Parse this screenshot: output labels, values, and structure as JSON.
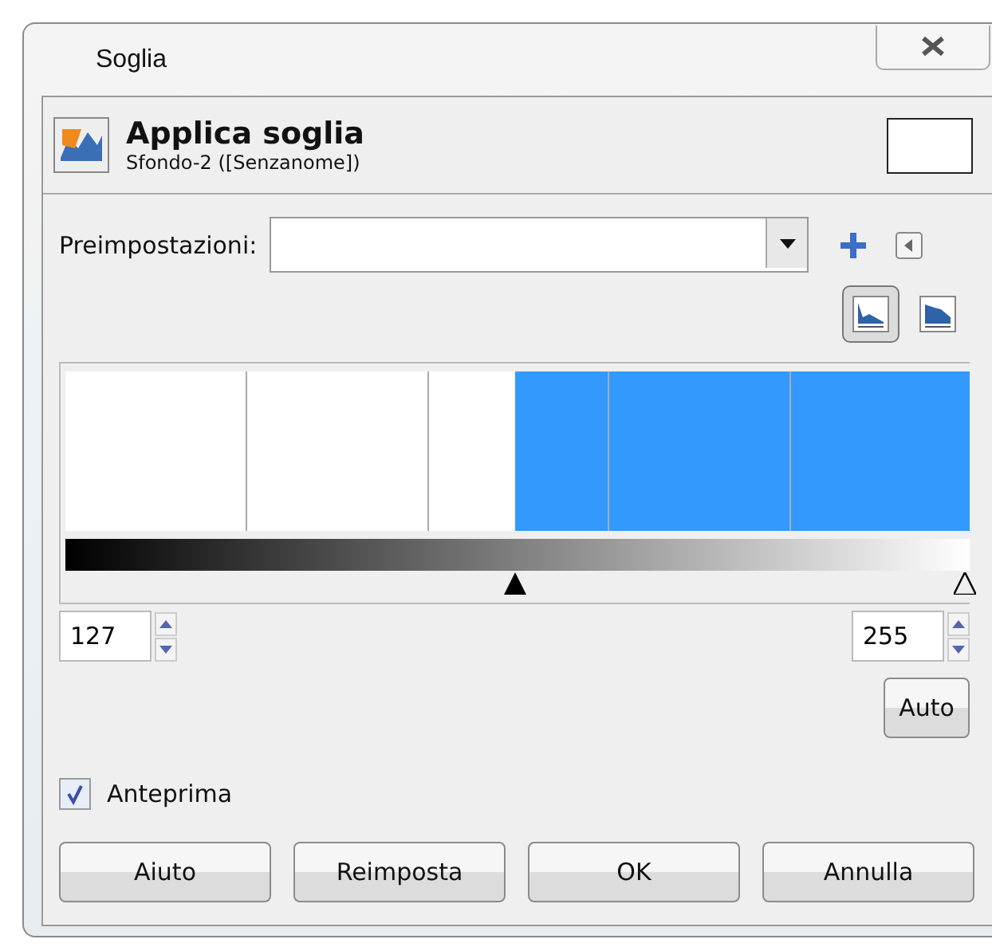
{
  "window": {
    "title": "Soglia"
  },
  "header": {
    "title": "Applica soglia",
    "subtitle": "Sfondo-2 ([Senzanome])"
  },
  "presets": {
    "label": "Preimpostazioni:"
  },
  "view_buttons": [
    {
      "kind": "linear",
      "selected": true
    },
    {
      "kind": "log",
      "selected": false
    }
  ],
  "threshold": {
    "low": {
      "value": "127",
      "level": 0.498
    },
    "high": {
      "value": "255",
      "level": 1
    }
  },
  "auto_button": "Auto",
  "preview": {
    "label": "Anteprima",
    "checked": true
  },
  "buttons": [
    "Aiuto",
    "Reimposta",
    "OK",
    "Annulla"
  ]
}
